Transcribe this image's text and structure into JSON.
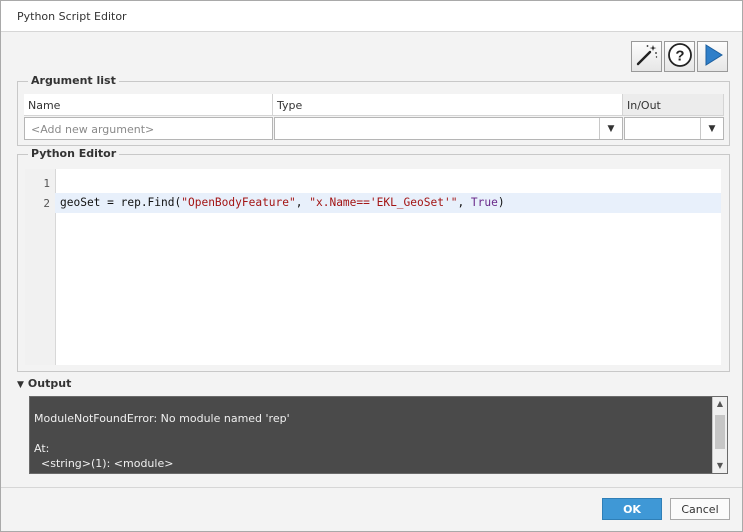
{
  "window": {
    "title": "Python Script Editor"
  },
  "toolbar": {
    "buttons": [
      {
        "icon": "magic-wand-icon"
      },
      {
        "icon": "help-icon",
        "glyph": "?"
      },
      {
        "icon": "run-icon"
      }
    ]
  },
  "argument_list": {
    "label": "Argument list",
    "columns": [
      "Name",
      "Type",
      "In/Out"
    ],
    "new_row": {
      "name_placeholder": "<Add new argument>",
      "type_value": "",
      "inout_value": ""
    }
  },
  "python_editor": {
    "label": "Python Editor",
    "lines": [
      {
        "number": "1",
        "code": ""
      },
      {
        "number": "2",
        "code": "geoSet = rep.Find(\"OpenBodyFeature\", \"x.Name=='EKL_GeoSet'\", True)"
      }
    ],
    "line2_parts": {
      "p1": "geoSet = rep.Find(",
      "s1": "\"OpenBodyFeature\"",
      "p2": ", ",
      "s2": "\"x.Name=='EKL_GeoSet'\"",
      "p3": ", ",
      "kw": "True",
      "p4": ")"
    }
  },
  "output": {
    "label": "Output",
    "lines": [
      "ModuleNotFoundError: No module named 'rep'",
      "",
      "At:",
      "  <string>(1): <module>"
    ]
  },
  "footer": {
    "ok_label": "OK",
    "cancel_label": "Cancel"
  },
  "colors": {
    "accent": "#3f98d6",
    "output_bg": "#4a4a4a",
    "active_line": "#e8f0fb"
  }
}
